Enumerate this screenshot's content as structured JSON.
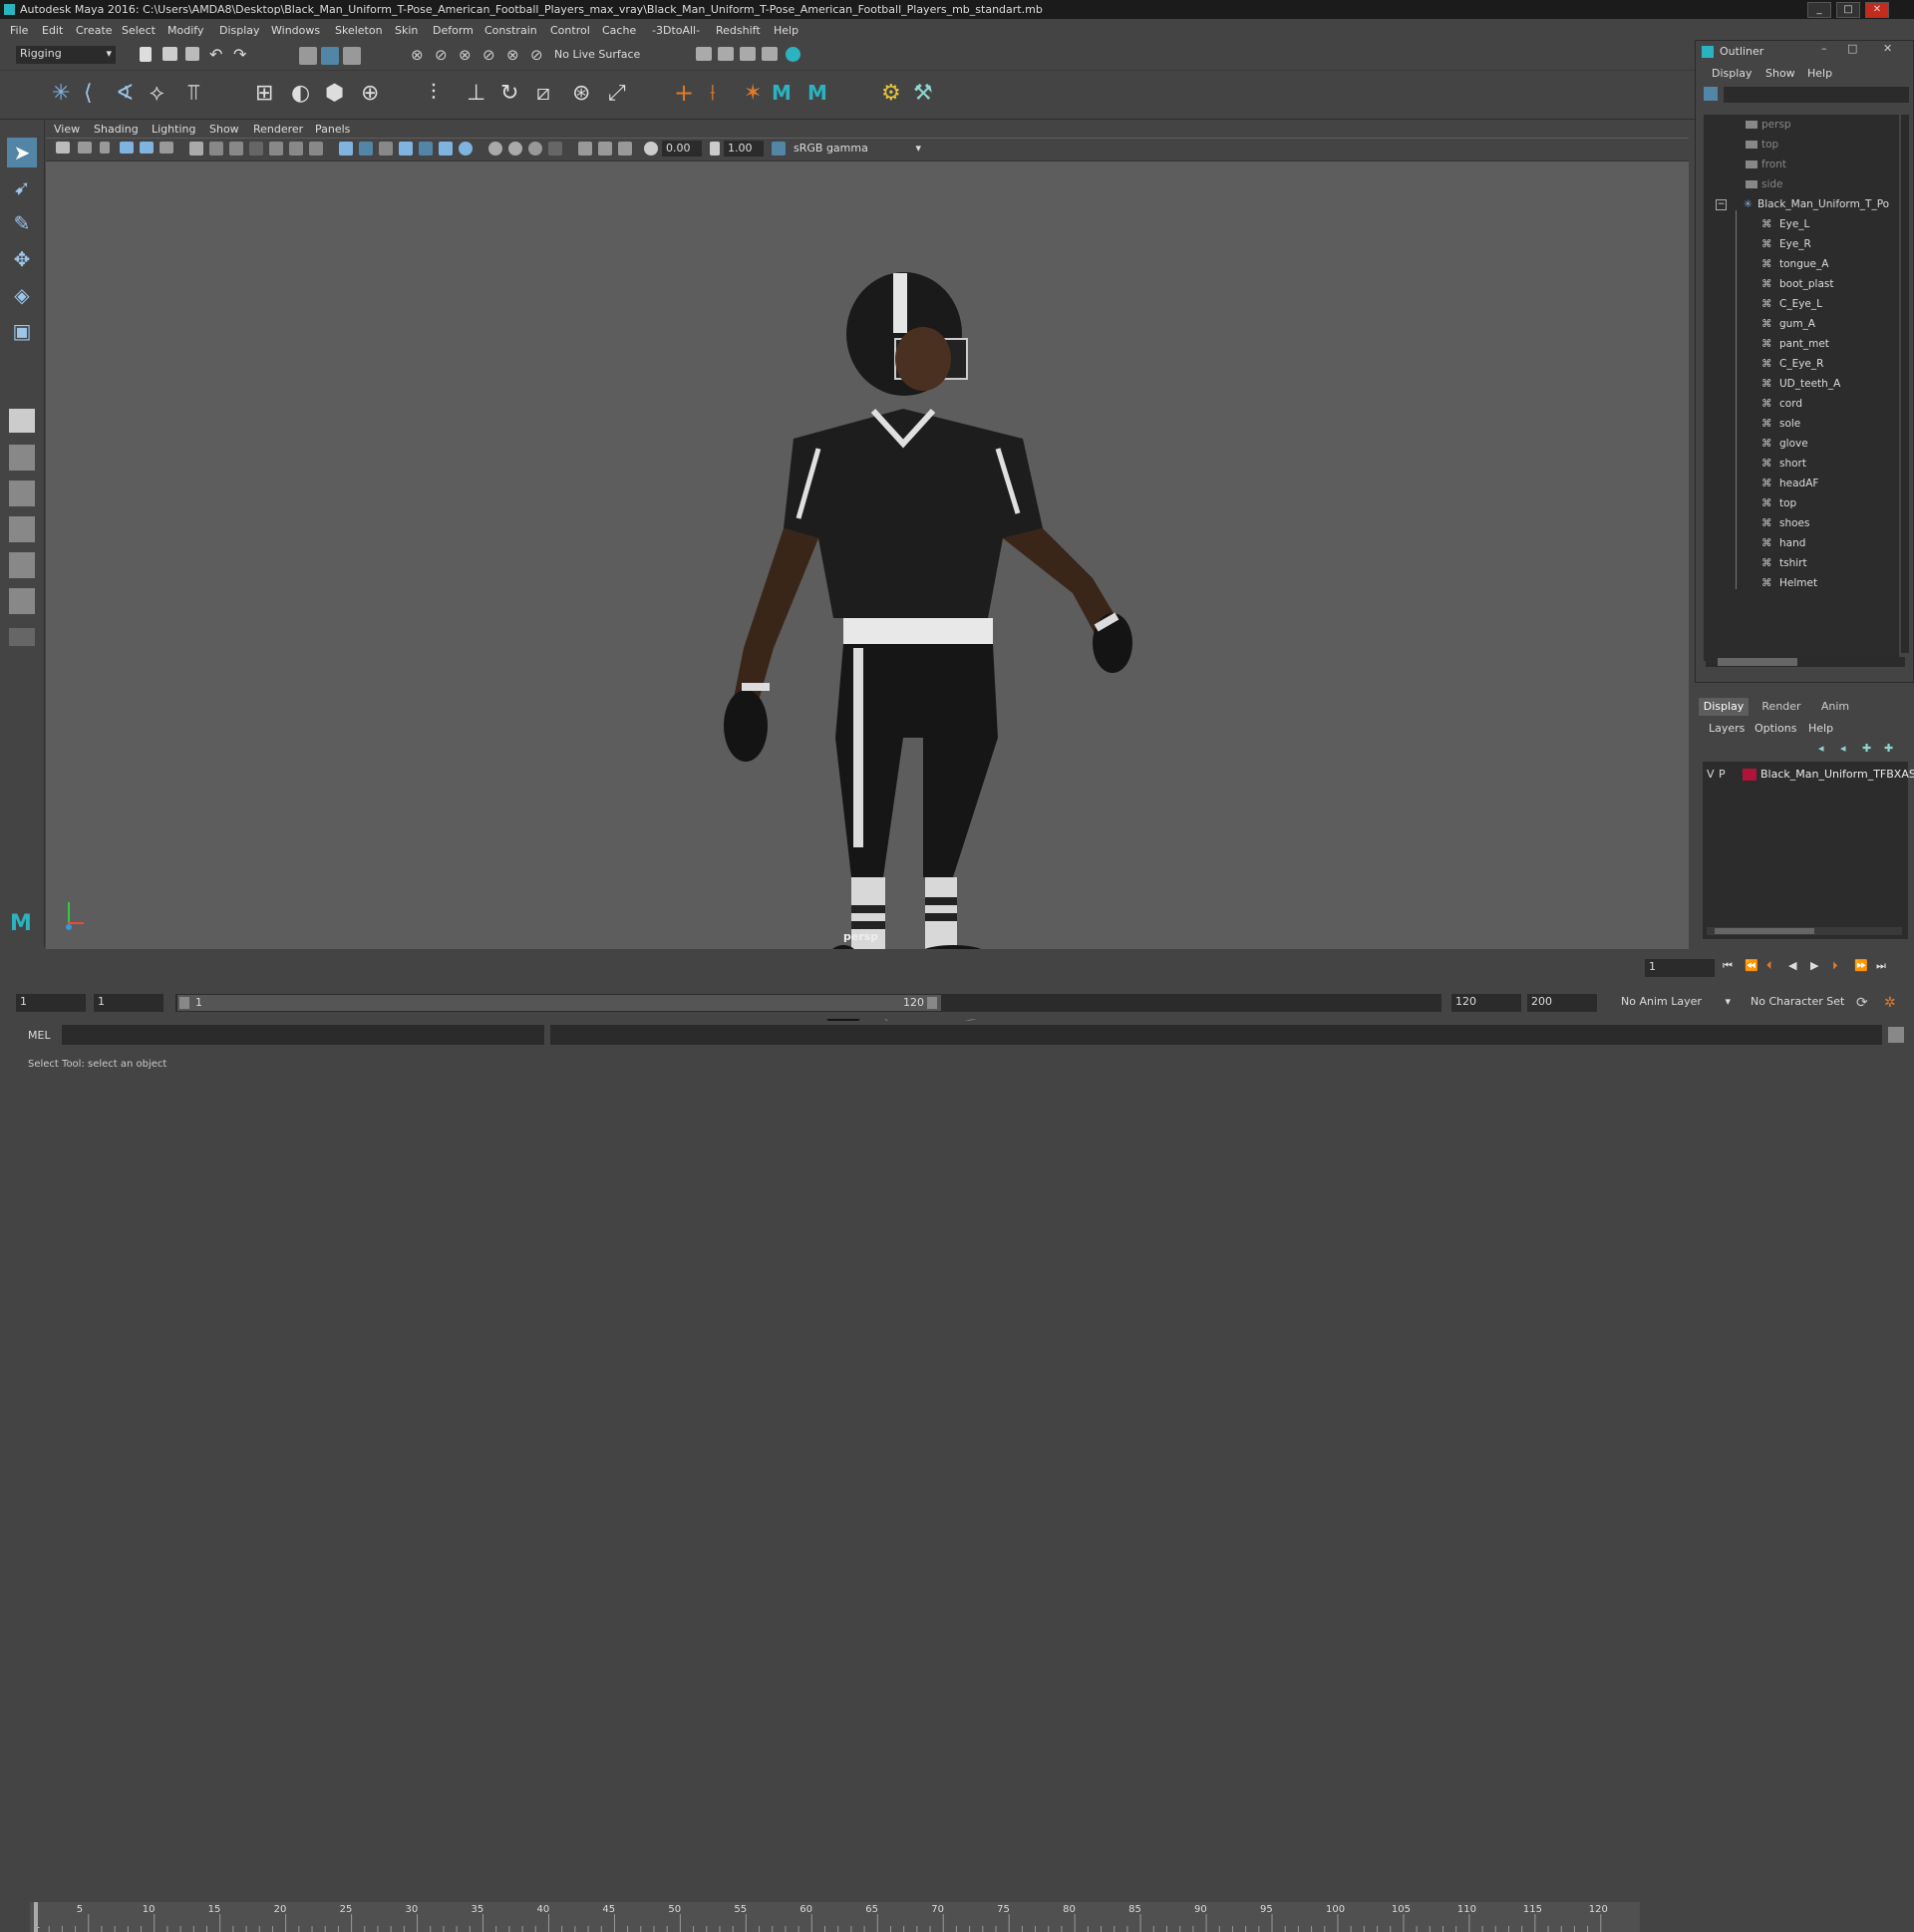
{
  "window": {
    "title": "Autodesk Maya 2016: C:\\Users\\AMDA8\\Desktop\\Black_Man_Uniform_T-Pose_American_Football_Players_max_vray\\Black_Man_Uniform_T-Pose_American_Football_Players_mb_standart.mb"
  },
  "menubar": {
    "items": [
      "File",
      "Edit",
      "Create",
      "Select",
      "Modify",
      "Display",
      "Windows",
      "Skeleton",
      "Skin",
      "Deform",
      "Constrain",
      "Control",
      "Cache",
      "-3DtoAll-",
      "Redshift",
      "Help"
    ]
  },
  "statusline": {
    "mode": "Rigging",
    "live_surface": "No Live Surface"
  },
  "panel": {
    "menu": [
      "View",
      "Shading",
      "Lighting",
      "Show",
      "Renderer",
      "Panels"
    ],
    "near_value": "0.00",
    "far_value": "1.00",
    "color_space": "sRGB gamma",
    "camera_label": "persp"
  },
  "outliner": {
    "title": "Outliner",
    "menu": [
      "Display",
      "Show",
      "Help"
    ],
    "cameras": [
      "persp",
      "top",
      "front",
      "side"
    ],
    "root": "Black_Man_Uniform_T_Po",
    "children": [
      "Eye_L",
      "Eye_R",
      "tongue_A",
      "boot_plast",
      "C_Eye_L",
      "gum_A",
      "pant_met",
      "C_Eye_R",
      "UD_teeth_A",
      "cord",
      "sole",
      "glove",
      "short",
      "headAF",
      "top",
      "shoes",
      "hand",
      "tshirt",
      "Helmet"
    ]
  },
  "layers": {
    "tabs": [
      "Display",
      "Render",
      "Anim"
    ],
    "menu": [
      "Layers",
      "Options",
      "Help"
    ],
    "layer": {
      "v": "V",
      "p": "P",
      "name": "Black_Man_Uniform_TFBXASC",
      "color": "#b0143a"
    }
  },
  "timeline": {
    "ticks": [
      "5",
      "10",
      "15",
      "20",
      "25",
      "30",
      "35",
      "40",
      "45",
      "50",
      "55",
      "60",
      "65",
      "70",
      "75",
      "80",
      "85",
      "90",
      "95",
      "100",
      "105",
      "110",
      "115",
      "120"
    ],
    "start_tick": "1",
    "current_frame": "1"
  },
  "range": {
    "start": "1",
    "playback_start": "1",
    "slider_start": "1",
    "slider_end": "120",
    "playback_end": "120",
    "end": "200",
    "anim_layer": "No Anim Layer",
    "character_set": "No Character Set"
  },
  "cmdline": {
    "lang": "MEL"
  },
  "helpline": {
    "text": "Select Tool: select an object"
  },
  "colors": {
    "accent": "#5285a6",
    "background": "#444444",
    "viewport": "#5d5d5d"
  }
}
